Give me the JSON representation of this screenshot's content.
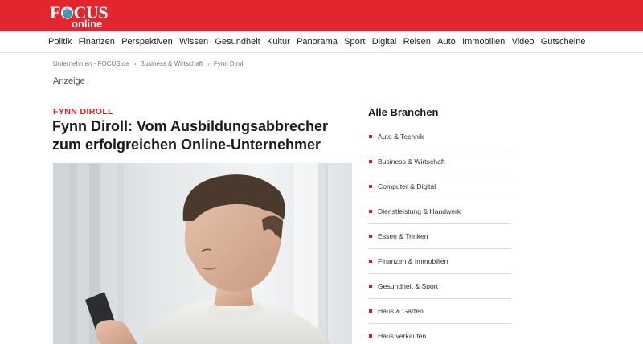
{
  "header": {
    "logo_focus": "FOCUS",
    "logo_online": "online",
    "brand_color": "#e1262d"
  },
  "nav": {
    "items": [
      "Politik",
      "Finanzen",
      "Perspektiven",
      "Wissen",
      "Gesundheit",
      "Kultur",
      "Panorama",
      "Sport",
      "Digital",
      "Reisen",
      "Auto",
      "Immobilien",
      "Video",
      "Gutscheine"
    ]
  },
  "breadcrumb": {
    "items": [
      "Unternehmen - FOCUS.de",
      "Business & Wirtschaft",
      "Fynn Diroll"
    ],
    "separator": "›"
  },
  "article": {
    "anzeige": "Anzeige",
    "kicker": "FYNN DIROLL",
    "headline": "Fynn Diroll: Vom Ausbildungsabbrecher zum erfolgreichen Online-Unternehmer",
    "accent_color": "#d61f26"
  },
  "sidebar": {
    "title": "Alle Branchen",
    "items": [
      "Auto & Technik",
      "Business & Wirtschaft",
      "Computer & Digital",
      "Dienstleistung & Handwerk",
      "Essen & Trinken",
      "Finanzen & Immobilien",
      "Gesundheit & Sport",
      "Haus & Garten",
      "Haus verkaufen"
    ]
  }
}
